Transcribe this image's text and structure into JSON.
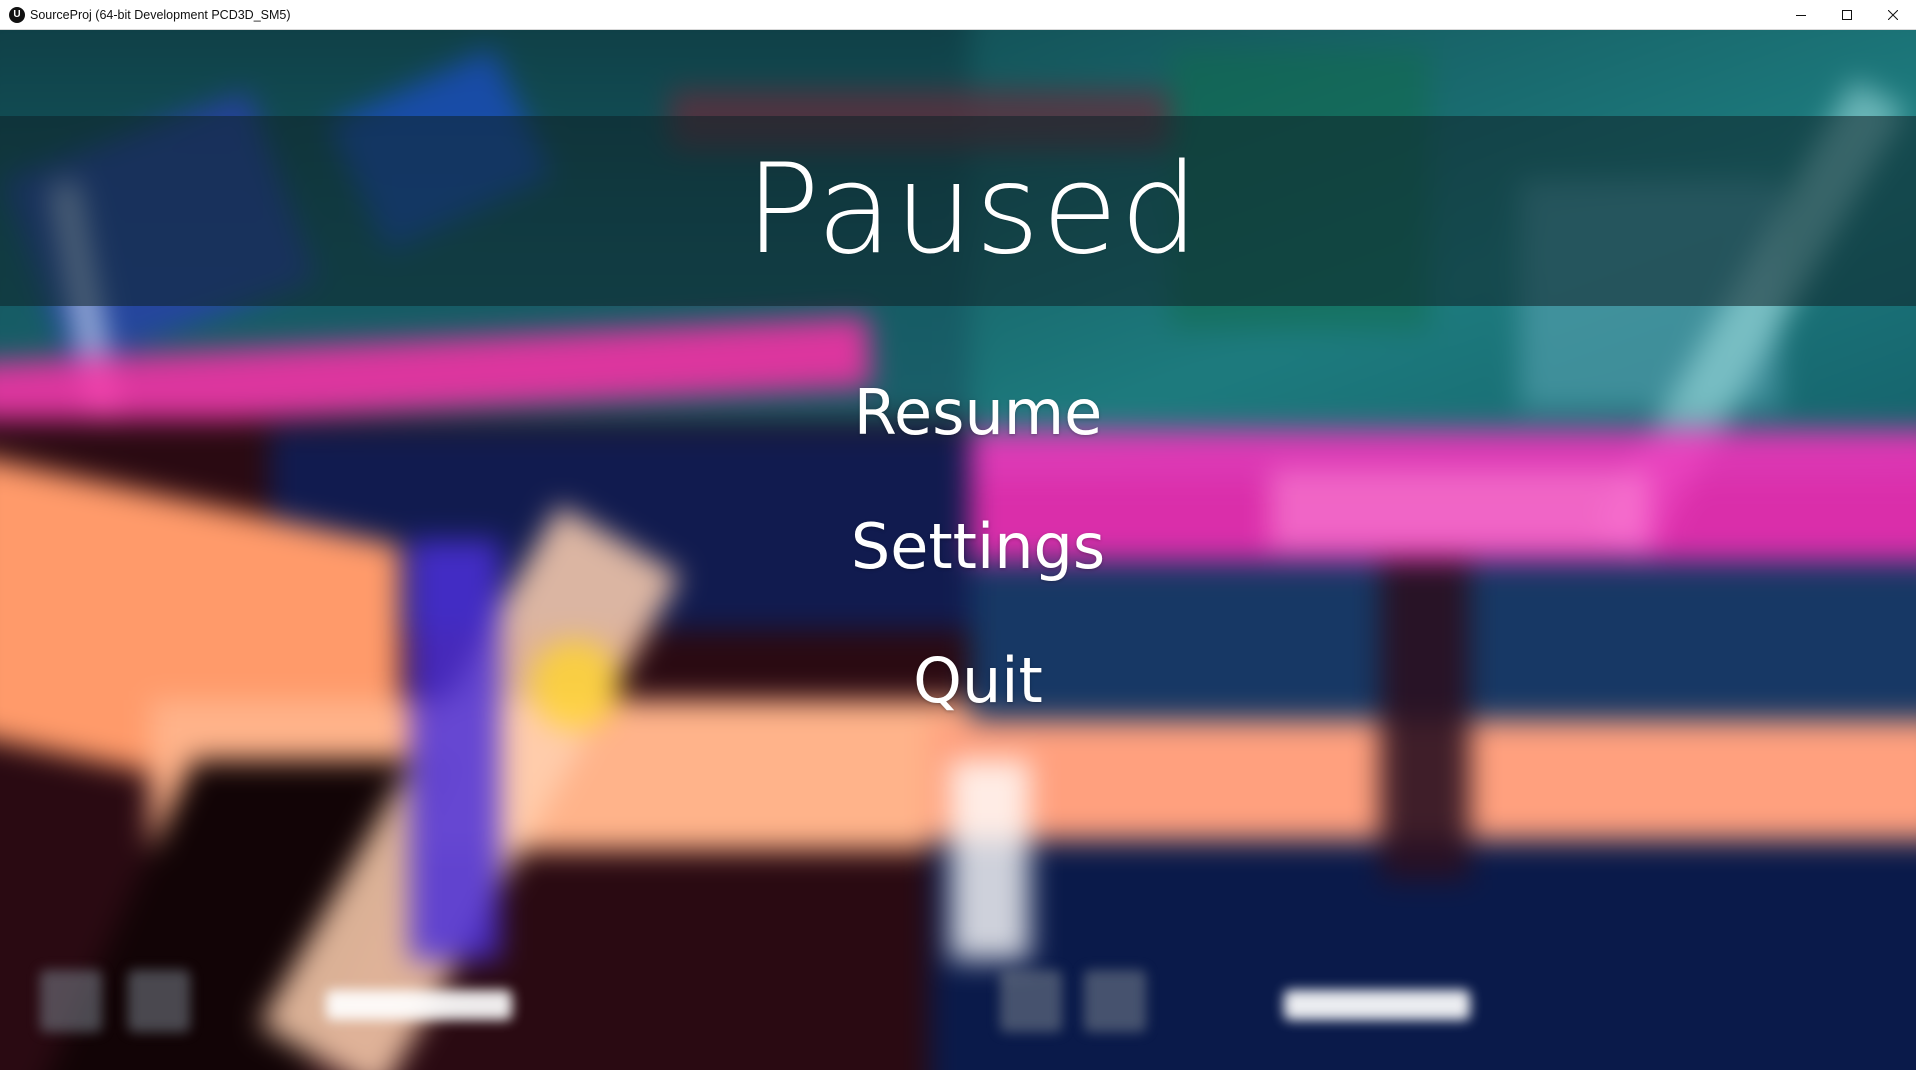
{
  "window": {
    "title": "SourceProj (64-bit Development PCD3D_SM5)",
    "app_icon_glyph": "U",
    "controls": [
      "minimize-icon",
      "maximize-icon",
      "close-icon"
    ]
  },
  "pause_menu": {
    "title": "Paused",
    "items": [
      {
        "label": "Resume"
      },
      {
        "label": "Settings"
      },
      {
        "label": "Quit"
      }
    ]
  },
  "colors": {
    "title_bar_bg": "#ffffff",
    "menu_text": "#ffffff",
    "banner_overlay": "#0f2328",
    "neon_orange": "#ff9a6a",
    "neon_magenta": "#ff2fa8",
    "teal": "#1b6f73"
  },
  "hud": {
    "icons": [
      "ability-slot-icon",
      "ability-slot-icon",
      "ability-slot-icon",
      "ability-slot-icon"
    ]
  }
}
